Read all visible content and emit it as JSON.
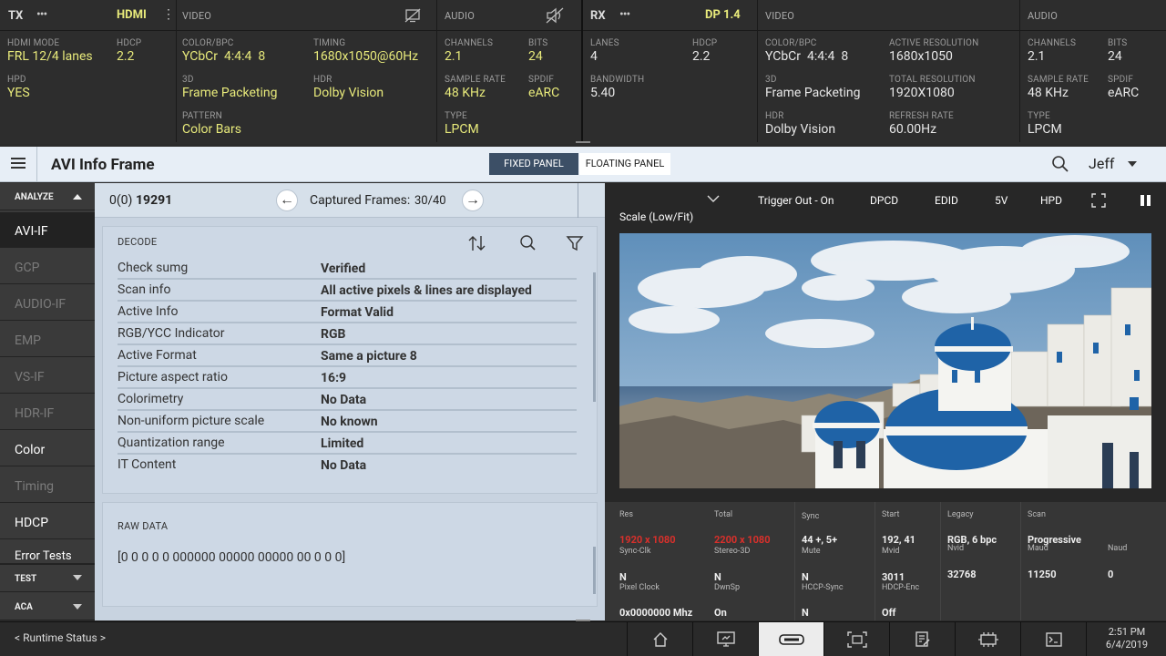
{
  "tx": {
    "title": "TX",
    "badge": "HDMI",
    "mode": {
      "hdmi_mode_label": "HDMI MODE",
      "hdmi_mode": "FRL 12/4 lanes",
      "hdcp_label": "HDCP",
      "hdcp": "2.2",
      "hpd_label": "HPD",
      "hpd": "YES"
    },
    "video": {
      "title": "VIDEO",
      "color_label": "COLOR/BPC",
      "color": "YCbCr  4:4:4  8",
      "timing_label": "TIMING",
      "timing": "1680x1050@60Hz",
      "three_d_label": "3D",
      "three_d": "Frame Packeting",
      "hdr_label": "HDR",
      "hdr": "Dolby Vision",
      "pattern_label": "PATTERN",
      "pattern": "Color Bars"
    },
    "audio": {
      "title": "AUDIO",
      "channels_label": "CHANNELS",
      "channels": "2.1",
      "bits_label": "BITS",
      "bits": "24",
      "rate_label": "SAMPLE RATE",
      "rate": "48 KHz",
      "spdif_label": "SPDIF",
      "spdif": "eARC",
      "type_label": "TYPE",
      "type": "LPCM"
    }
  },
  "rx": {
    "title": "RX",
    "badge": "DP 1.4",
    "link": {
      "lanes_label": "LANES",
      "lanes": "4",
      "hdcp_label": "HDCP",
      "hdcp": "2.2",
      "bw_label": "BANDWIDTH",
      "bw": "5.40"
    },
    "video": {
      "title": "VIDEO",
      "color_label": "COLOR/BPC",
      "color": "YCbCr  4:4:4  8",
      "active_label": "ACTIVE RESOLUTION",
      "active": "1680x1050",
      "three_d_label": "3D",
      "three_d": "Frame Packeting",
      "total_label": "TOTAL RESOLUTION",
      "total": "1920X1080",
      "hdr_label": "HDR",
      "hdr": "Dolby Vision",
      "refresh_label": "REFRESH RATE",
      "refresh": "60.00Hz"
    },
    "audio": {
      "title": "AUDIO",
      "channels_label": "CHANNELS",
      "channels": "2.1",
      "bits_label": "BITS",
      "bits": "24",
      "rate_label": "SAMPLE RATE",
      "rate": "48 KHz",
      "spdif_label": "SPDIF",
      "spdif": "eARC",
      "type_label": "TYPE",
      "type": "LPCM"
    }
  },
  "header": {
    "title": "AVI Info Frame",
    "fixed": "FIXED PANEL",
    "floating": "FLOATING PANEL",
    "user": "Jeff"
  },
  "sidebar": {
    "analyze": "ANALYZE",
    "items": [
      "AVI-IF",
      "GCP",
      "AUDIO-IF",
      "EMP",
      "VS-IF",
      "HDR-IF",
      "Color",
      "Timing",
      "HDCP",
      "Error Tests"
    ],
    "test": "TEST",
    "aca": "ACA"
  },
  "decode": {
    "frame_id": "0(0)",
    "frame_num": "19291",
    "captured_label": "Captured Frames:",
    "captured": "30/40",
    "title": "DECODE",
    "rows": [
      {
        "k": "Check sumg",
        "v": "Verified"
      },
      {
        "k": "Scan info",
        "v": "All active pixels & lines are displayed"
      },
      {
        "k": "Active Info",
        "v": "Format Valid"
      },
      {
        "k": "RGB/YCC Indicator",
        "v": "RGB"
      },
      {
        "k": "Active Format",
        "v": "Same a picture 8"
      },
      {
        "k": "Picture aspect ratio",
        "v": "16:9"
      },
      {
        "k": "Colorimetry",
        "v": "No Data"
      },
      {
        "k": "Non-uniform picture scale",
        "v": "No known"
      },
      {
        "k": "Quantization range",
        "v": "Limited"
      },
      {
        "k": "IT Content",
        "v": "No Data"
      }
    ],
    "raw_title": "RAW DATA",
    "raw": "[0 0 0 0 0 000000 00000 00000 00 0 0 0]"
  },
  "video": {
    "trigger": "Trigger Out - On",
    "dpcd": "DPCD",
    "edid": "EDID",
    "fivev": "5V",
    "hpd": "HPD",
    "scale": "Scale (Low/Fit)"
  },
  "stats": {
    "res_l": "Res",
    "res": "1920 x 1080",
    "total_l": "Total",
    "total": "2200 x 1080",
    "sync_l": "Sync",
    "sync": "44 +, 5+",
    "start_l": "Start",
    "start": "192, 41",
    "legacy_l": "Legacy",
    "legacy": "RGB, 6 bpc",
    "scan_l": "Scan",
    "scan": "Progressive",
    "syncclk_l": "Sync-Clk",
    "syncclk": "N",
    "stereo_l": "Stereo-3D",
    "stereo": "N",
    "mute_l": "Mute",
    "mute": "N",
    "mvid_l": "Mvid",
    "mvid": "3011",
    "nvid_l": "Nvid",
    "nvid": "32768",
    "maud_l": "Maud",
    "maud": "11250",
    "naud_l": "Naud",
    "naud": "0",
    "pclk_l": "Pixel Clock",
    "pclk": "0x0000000 Mhz",
    "dwnsp_l": "DwnSp",
    "dwnsp": "On",
    "hccp_l": "HCCP-Sync",
    "hccp": "N",
    "hdcpenc_l": "HDCP-Enc",
    "hdcpenc": "Off"
  },
  "footer": {
    "runtime": "< Runtime Status >",
    "time": "2:51 PM",
    "date": "6/4/2019"
  }
}
